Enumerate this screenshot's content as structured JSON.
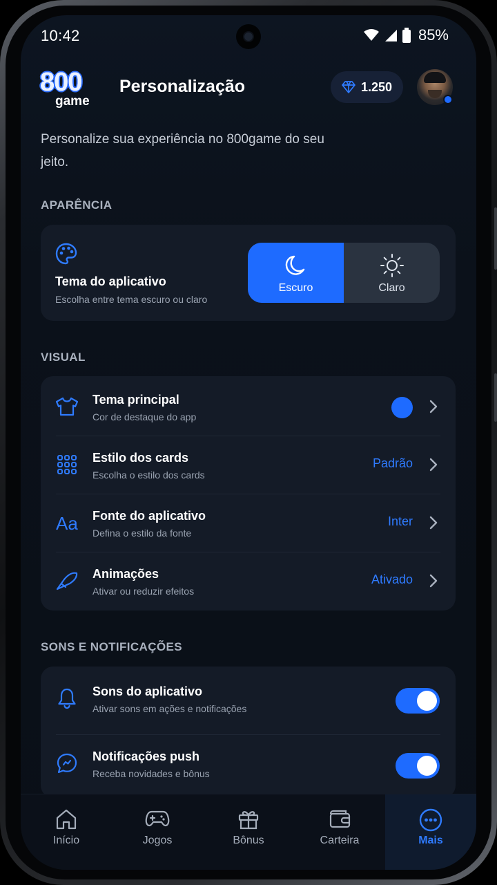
{
  "status_bar": {
    "time": "10:42",
    "battery": "85%"
  },
  "header": {
    "logo_number": "800",
    "logo_word": "game",
    "title": "Personalização",
    "gems": "1.250"
  },
  "intro": "Personalize sua experiência no 800game do seu jeito.",
  "appearance": {
    "section": "APARÊNCIA",
    "title": "Tema do aplicativo",
    "subtitle": "Escolha entre tema escuro ou claro",
    "options": [
      {
        "label": "Escuro",
        "selected": true
      },
      {
        "label": "Claro",
        "selected": false
      }
    ]
  },
  "visual": {
    "section": "VISUAL",
    "rows": [
      {
        "title": "Tema principal",
        "subtitle": "Cor de destaque do app",
        "value": "",
        "icon": "tshirt-icon",
        "swatch": "#1e6bff"
      },
      {
        "title": "Estilo dos cards",
        "subtitle": "Escolha o estilo dos cards",
        "value": "Padrão",
        "icon": "grid-icon"
      },
      {
        "title": "Fonte do aplicativo",
        "subtitle": "Defina o estilo da fonte",
        "value": "Inter",
        "icon": "font-icon"
      },
      {
        "title": "Animações",
        "subtitle": "Ativar ou reduzir efeitos",
        "value": "Ativado",
        "icon": "motion-icon"
      }
    ]
  },
  "sounds": {
    "section": "SONS E NOTIFICAÇÕES",
    "rows": [
      {
        "title": "Sons do aplicativo",
        "subtitle": "Ativar sons em ações e notificações",
        "enabled": true,
        "icon": "bell-icon"
      },
      {
        "title": "Notificações push",
        "subtitle": "Receba novidades e bônus",
        "enabled": true,
        "icon": "chat-icon"
      }
    ]
  },
  "nav": {
    "items": [
      {
        "label": "Início",
        "icon": "home-icon"
      },
      {
        "label": "Jogos",
        "icon": "gamepad-icon"
      },
      {
        "label": "Bônus",
        "icon": "gift-icon"
      },
      {
        "label": "Carteira",
        "icon": "wallet-icon"
      },
      {
        "label": "Mais",
        "icon": "more-icon",
        "active": true
      }
    ]
  },
  "colors": {
    "accent": "#1e6bff",
    "background": "#0b111a",
    "card": "#141b27"
  }
}
